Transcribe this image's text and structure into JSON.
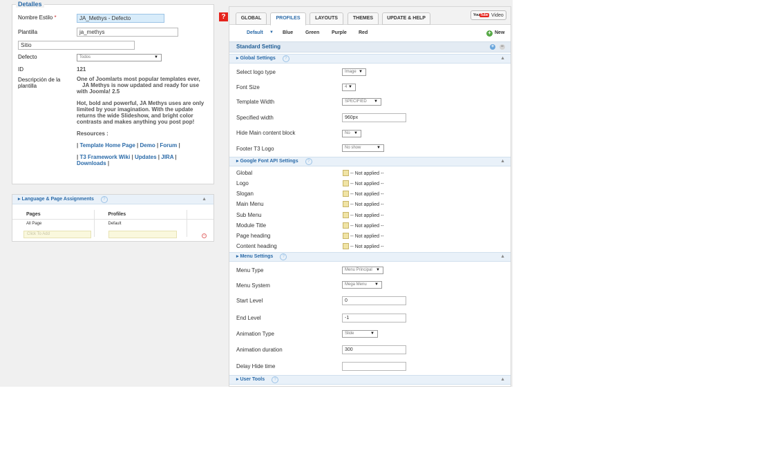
{
  "details": {
    "legend": "Detalles",
    "nombre_label": "Nombre Estilo",
    "nombre_req": "*",
    "nombre_value": "JA_Methys - Defecto",
    "plantilla_label": "Plantilla",
    "plantilla_value": "ja_methys",
    "sitio_value": "Sitio",
    "defecto_label": "Defecto",
    "defecto_value": "Todos",
    "id_label": "ID",
    "id_value": "121",
    "desc_label": "Descripción de la plantilla",
    "desc_p1_line1": "One of Joomlarts most popular templates ever,",
    "desc_p1_line2": "JA Methys is now updated and ready for use",
    "desc_p1_line3": "with Joomla! 2.5",
    "desc_p2_line1": "Hot, bold and powerful, JA Methys uses are only",
    "desc_p2_line2": "limited by your imagination. With the update",
    "desc_p2_line3": "returns the wide Slideshow, and bright color",
    "desc_p2_line4": "contrasts and makes anything you post pop!",
    "resources": "Resources :",
    "links1": [
      "Template Home Page",
      "Demo",
      "Forum"
    ],
    "links2": [
      "T3 Framework Wiki",
      "Updates",
      "JIRA",
      "Downloads"
    ]
  },
  "lang": {
    "title": "Language & Page Assignments",
    "help": "?",
    "col_pages": "Pages",
    "col_profiles": "Profiles",
    "row_page": "All Page",
    "row_profile": "Default",
    "add_placeholder": "Click To Add"
  },
  "tabs": [
    "GLOBAL",
    "PROFILES",
    "LAYOUTS",
    "THEMES",
    "UPDATE & HELP"
  ],
  "video_label": "Video",
  "youtube_text": "You",
  "youtube_tube": "Tube",
  "profiles": [
    "Default",
    "Blue",
    "Green",
    "Purple",
    "Red"
  ],
  "new_label": "New",
  "standard_setting": "Standard Setting",
  "sections": {
    "global": "Global Settings",
    "font": "Google Font API Settings",
    "menu": "Menu Settings",
    "user": "User Tools"
  },
  "global_settings": {
    "logo_label": "Select logo type",
    "logo_value": "Image",
    "fontsize_label": "Font Size",
    "fontsize_value": "4",
    "width_label": "Template Width",
    "width_value": "SPECIFIED",
    "spec_label": "Specified width",
    "spec_value": "960px",
    "hide_label": "Hide Main content block",
    "hide_value": "No",
    "footer_label": "Footer T3 Logo",
    "footer_value": "No show"
  },
  "font_rows": [
    "Global",
    "Logo",
    "Slogan",
    "Main Menu",
    "Sub Menu",
    "Module Title",
    "Page heading",
    "Content heading"
  ],
  "not_applied": "-- Not applied --",
  "menu_settings": {
    "type_label": "Menu Type",
    "type_value": "Menu Principal",
    "system_label": "Menu System",
    "system_value": "Mega Menu",
    "start_label": "Start Level",
    "start_value": "0",
    "end_label": "End Level",
    "end_value": "-1",
    "anim_label": "Animation Type",
    "anim_value": "Slide",
    "dur_label": "Animation duration",
    "dur_value": "300",
    "delay_label": "Delay Hide time",
    "delay_value": ""
  }
}
